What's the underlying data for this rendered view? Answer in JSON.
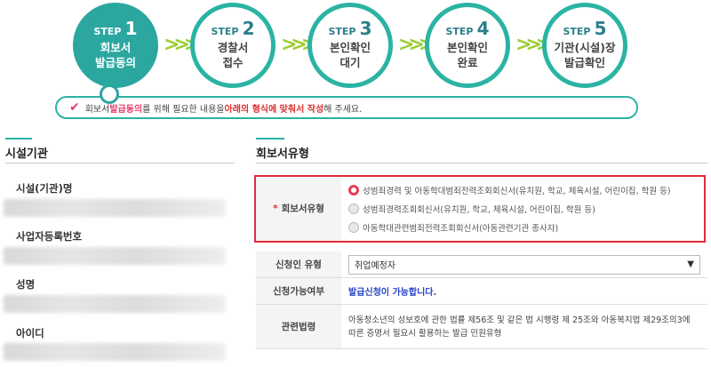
{
  "steps": [
    {
      "word": "STEP",
      "num": "1",
      "name1": "회보서",
      "name2": "발급동의",
      "active": true
    },
    {
      "word": "STEP",
      "num": "2",
      "name1": "경찰서",
      "name2": "접수",
      "active": false
    },
    {
      "word": "STEP",
      "num": "3",
      "name1": "본인확인",
      "name2": "대기",
      "active": false
    },
    {
      "word": "STEP",
      "num": "4",
      "name1": "본인확인",
      "name2": "완료",
      "active": false
    },
    {
      "word": "STEP",
      "num": "5",
      "name1": "기관(시설)장",
      "name2": "발급확인",
      "active": false
    }
  ],
  "notice": {
    "prefix": "회보서 ",
    "highlight1": "발급동의",
    "middle": "를 위해 필요한 내용을 ",
    "highlight2": "아래의 형식에 맞춰서 작성",
    "suffix": "해 주세요."
  },
  "facility": {
    "title": "시설기관",
    "fields": [
      "시설(기관)명",
      "사업자등록번호",
      "성명",
      "아이디"
    ]
  },
  "report": {
    "title": "회보서유형",
    "type_label": "회보서유형",
    "required_mark": "*",
    "options": [
      "성범죄경력 및 아동학대범죄전력조회회신서(유치원, 학교, 체육시설, 어린이집, 학원 등)",
      "성범죄경력조회회신서(유치원, 학교, 체육시설, 어린이집, 학원 등)",
      "아동학대관련범죄전력조회회신서(아동관련기관 종사자)"
    ],
    "applicant_label": "신청인 유형",
    "applicant_value": "취업예정자",
    "possible_label": "신청가능여부",
    "possible_value": "발급신청이 가능합니다.",
    "law_label": "관련법령",
    "law_line1": "아동청소년의 성보호에 관한 법률 제56조 및 같은 법 시행령 제 25조와 아동복지법 제29조의3에",
    "law_line2": "따른 증명서 필요시 활용하는 발급 민원유형"
  },
  "colors": {
    "teal": "#2ba7a0",
    "lime": "#9acd32",
    "red": "#e02b3a",
    "pink": "#e83e6c",
    "blue": "#2743c8"
  }
}
